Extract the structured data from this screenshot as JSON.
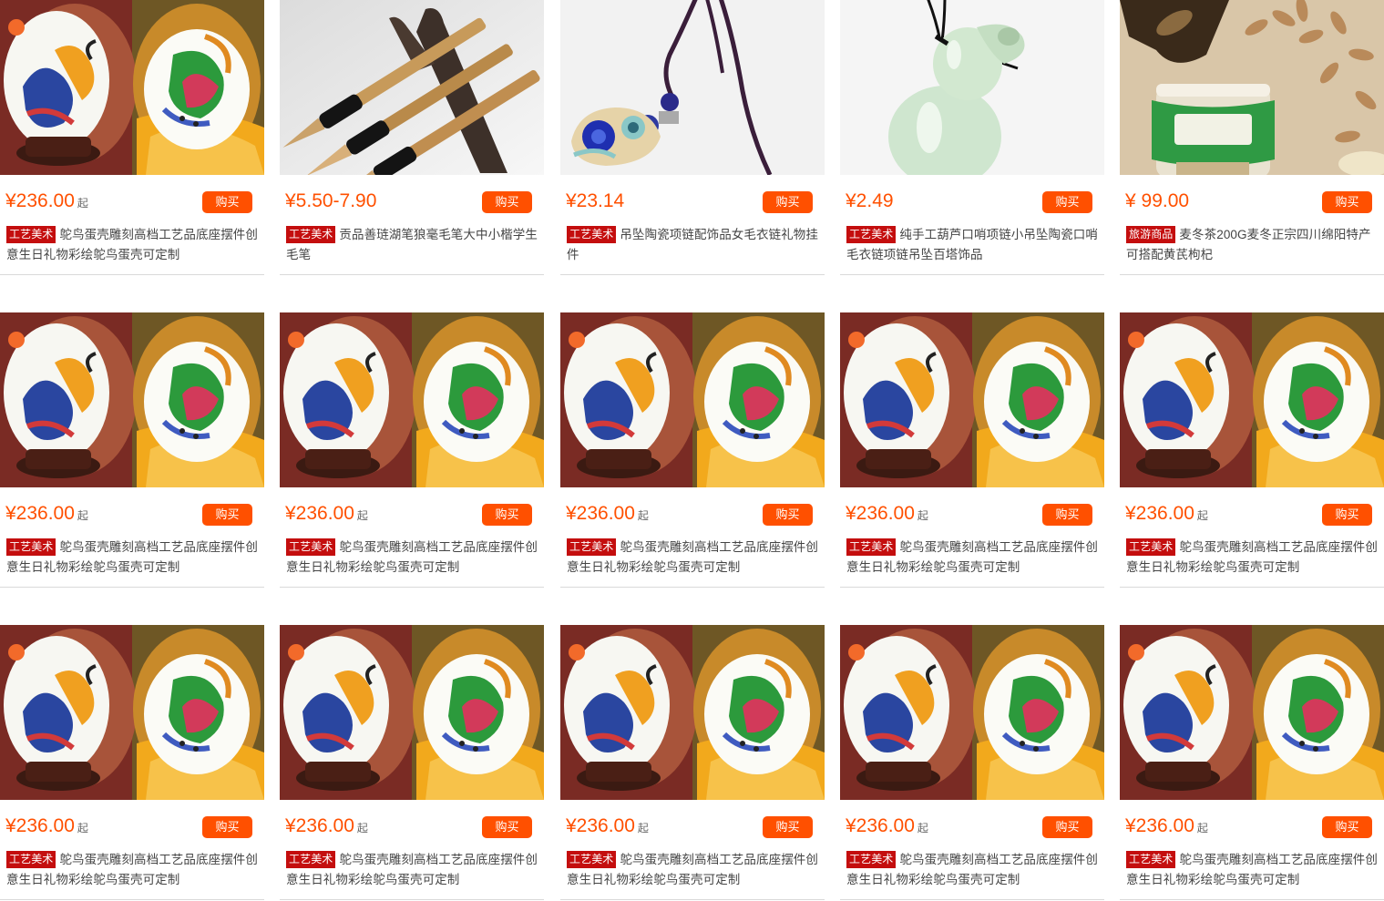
{
  "products": [
    {
      "image": "ostrich-egg",
      "price": "¥236.00",
      "price_suffix": "起",
      "buy_label": "购买",
      "tag": "工艺美术",
      "title": "鸵鸟蛋壳雕刻高档工艺品底座摆件创意生日礼物彩绘鸵鸟蛋壳可定制"
    },
    {
      "image": "brushes",
      "price": "¥5.50-7.90",
      "price_suffix": "",
      "buy_label": "购买",
      "tag": "工艺美术",
      "title": "贡品善琏湖笔狼毫毛笔大中小楷学生毛笔"
    },
    {
      "image": "pendant",
      "price": "¥23.14",
      "price_suffix": "",
      "buy_label": "购买",
      "tag": "工艺美术",
      "title": "吊坠陶瓷项链配饰品女毛衣链礼物挂件"
    },
    {
      "image": "gourd",
      "price": "¥2.49",
      "price_suffix": "",
      "buy_label": "购买",
      "tag": "工艺美术",
      "title": "纯手工葫芦口哨项链小吊坠陶瓷口哨毛衣链项链吊坠百塔饰品"
    },
    {
      "image": "tea",
      "price": "¥ 99.00",
      "price_suffix": "",
      "buy_label": "购买",
      "tag": "旅游商品",
      "title": "麦冬茶200G麦冬正宗四川绵阳特产可搭配黄芪枸杞"
    },
    {
      "image": "ostrich-egg",
      "price": "¥236.00",
      "price_suffix": "起",
      "buy_label": "购买",
      "tag": "工艺美术",
      "title": "鸵鸟蛋壳雕刻高档工艺品底座摆件创意生日礼物彩绘鸵鸟蛋壳可定制"
    },
    {
      "image": "ostrich-egg",
      "price": "¥236.00",
      "price_suffix": "起",
      "buy_label": "购买",
      "tag": "工艺美术",
      "title": "鸵鸟蛋壳雕刻高档工艺品底座摆件创意生日礼物彩绘鸵鸟蛋壳可定制"
    },
    {
      "image": "ostrich-egg",
      "price": "¥236.00",
      "price_suffix": "起",
      "buy_label": "购买",
      "tag": "工艺美术",
      "title": "鸵鸟蛋壳雕刻高档工艺品底座摆件创意生日礼物彩绘鸵鸟蛋壳可定制"
    },
    {
      "image": "ostrich-egg",
      "price": "¥236.00",
      "price_suffix": "起",
      "buy_label": "购买",
      "tag": "工艺美术",
      "title": "鸵鸟蛋壳雕刻高档工艺品底座摆件创意生日礼物彩绘鸵鸟蛋壳可定制"
    },
    {
      "image": "ostrich-egg",
      "price": "¥236.00",
      "price_suffix": "起",
      "buy_label": "购买",
      "tag": "工艺美术",
      "title": "鸵鸟蛋壳雕刻高档工艺品底座摆件创意生日礼物彩绘鸵鸟蛋壳可定制"
    },
    {
      "image": "ostrich-egg",
      "price": "¥236.00",
      "price_suffix": "起",
      "buy_label": "购买",
      "tag": "工艺美术",
      "title": "鸵鸟蛋壳雕刻高档工艺品底座摆件创意生日礼物彩绘鸵鸟蛋壳可定制"
    },
    {
      "image": "ostrich-egg",
      "price": "¥236.00",
      "price_suffix": "起",
      "buy_label": "购买",
      "tag": "工艺美术",
      "title": "鸵鸟蛋壳雕刻高档工艺品底座摆件创意生日礼物彩绘鸵鸟蛋壳可定制"
    },
    {
      "image": "ostrich-egg",
      "price": "¥236.00",
      "price_suffix": "起",
      "buy_label": "购买",
      "tag": "工艺美术",
      "title": "鸵鸟蛋壳雕刻高档工艺品底座摆件创意生日礼物彩绘鸵鸟蛋壳可定制"
    },
    {
      "image": "ostrich-egg",
      "price": "¥236.00",
      "price_suffix": "起",
      "buy_label": "购买",
      "tag": "工艺美术",
      "title": "鸵鸟蛋壳雕刻高档工艺品底座摆件创意生日礼物彩绘鸵鸟蛋壳可定制"
    },
    {
      "image": "ostrich-egg",
      "price": "¥236.00",
      "price_suffix": "起",
      "buy_label": "购买",
      "tag": "工艺美术",
      "title": "鸵鸟蛋壳雕刻高档工艺品底座摆件创意生日礼物彩绘鸵鸟蛋壳可定制"
    }
  ],
  "colors": {
    "price": "#ff5000",
    "buy_button": "#ff5000",
    "tag_background": "#c40e0e",
    "divider": "#d9d9d9",
    "title_text": "#444444"
  }
}
